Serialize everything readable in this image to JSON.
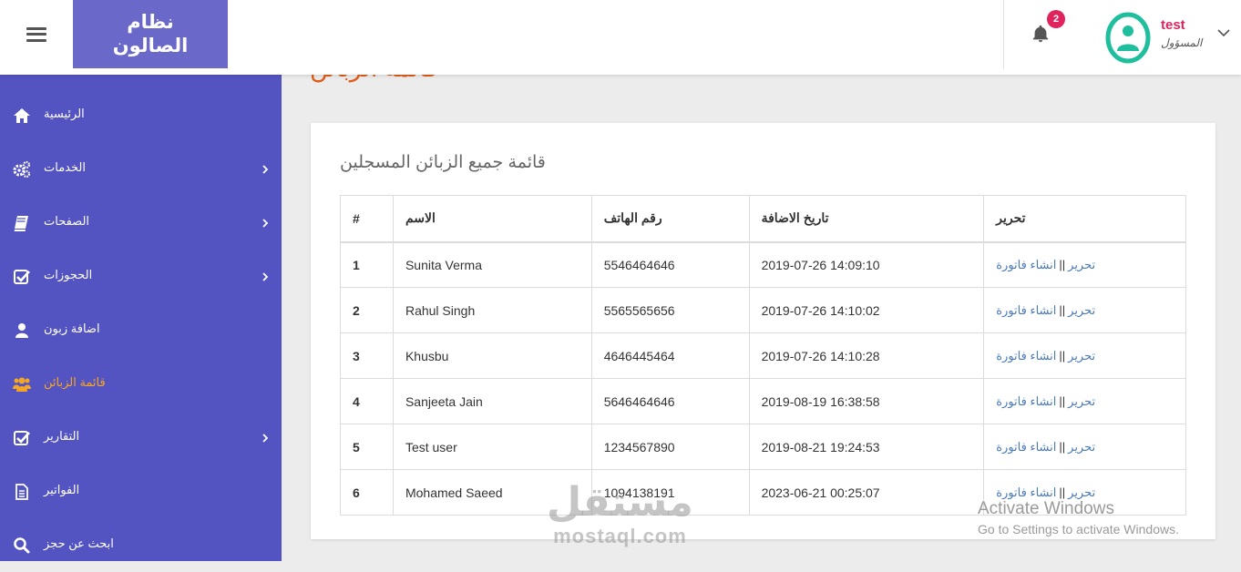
{
  "brand": {
    "line1": "نظام",
    "line2": "الصالون"
  },
  "notifications": {
    "count": "2"
  },
  "user": {
    "name": "test",
    "role": "المسؤول"
  },
  "sidebar": {
    "items": [
      {
        "label": "الرئيسية",
        "icon": "home-icon",
        "has_submenu": false
      },
      {
        "label": "الخدمات",
        "icon": "cogs-icon",
        "has_submenu": true
      },
      {
        "label": "الصفحات",
        "icon": "book-icon",
        "has_submenu": true
      },
      {
        "label": "الحجوزات",
        "icon": "check-square-icon",
        "has_submenu": true
      },
      {
        "label": "اضافة زبون",
        "icon": "user-icon",
        "has_submenu": false
      },
      {
        "label": "قائمة الزبائن",
        "icon": "users-icon",
        "has_submenu": false,
        "active": true
      },
      {
        "label": "التقارير",
        "icon": "check-square-icon",
        "has_submenu": true
      },
      {
        "label": "الفواتير",
        "icon": "file-icon",
        "has_submenu": false
      },
      {
        "label": "ابحث عن حجز",
        "icon": "search-icon",
        "has_submenu": false
      }
    ]
  },
  "page": {
    "title": "قائمة الزبائن"
  },
  "card": {
    "title": "قائمة جميع الزبائن المسجلين"
  },
  "table": {
    "headers": [
      "#",
      "الاسم",
      "رقم الهاتف",
      "تاريخ الاضافة",
      "تحرير"
    ],
    "edit_label": "تحرير",
    "separator": "||",
    "invoice_label": "انشاء فاتورة",
    "rows": [
      {
        "num": "1",
        "name": "Sunita Verma",
        "phone": "5546464646",
        "date": "2019-07-26 14:09:10"
      },
      {
        "num": "2",
        "name": "Rahul Singh",
        "phone": "5565565656",
        "date": "2019-07-26 14:10:02"
      },
      {
        "num": "3",
        "name": "Khusbu",
        "phone": "4646445464",
        "date": "2019-07-26 14:10:28"
      },
      {
        "num": "4",
        "name": "Sanjeeta Jain",
        "phone": "5646464646",
        "date": "2019-08-19 16:38:58"
      },
      {
        "num": "5",
        "name": "Test user",
        "phone": "1234567890",
        "date": "2019-08-21 19:24:53"
      },
      {
        "num": "6",
        "name": "Mohamed Saeed",
        "phone": "1094138191",
        "date": "2023-06-21 00:25:07"
      }
    ]
  },
  "activation": {
    "line1": "Activate Windows",
    "line2": "Go to Settings to activate Windows."
  },
  "watermark": {
    "arabic": "مستقل",
    "latin": "mostaql.com"
  },
  "colors": {
    "sidebar": "#5353c1",
    "brand": "#6a68c8",
    "active": "#f5a623",
    "title": "#e25c19",
    "badge": "#e0245e",
    "avatar": "#1fbf9d",
    "link": "#4a7ab8"
  }
}
